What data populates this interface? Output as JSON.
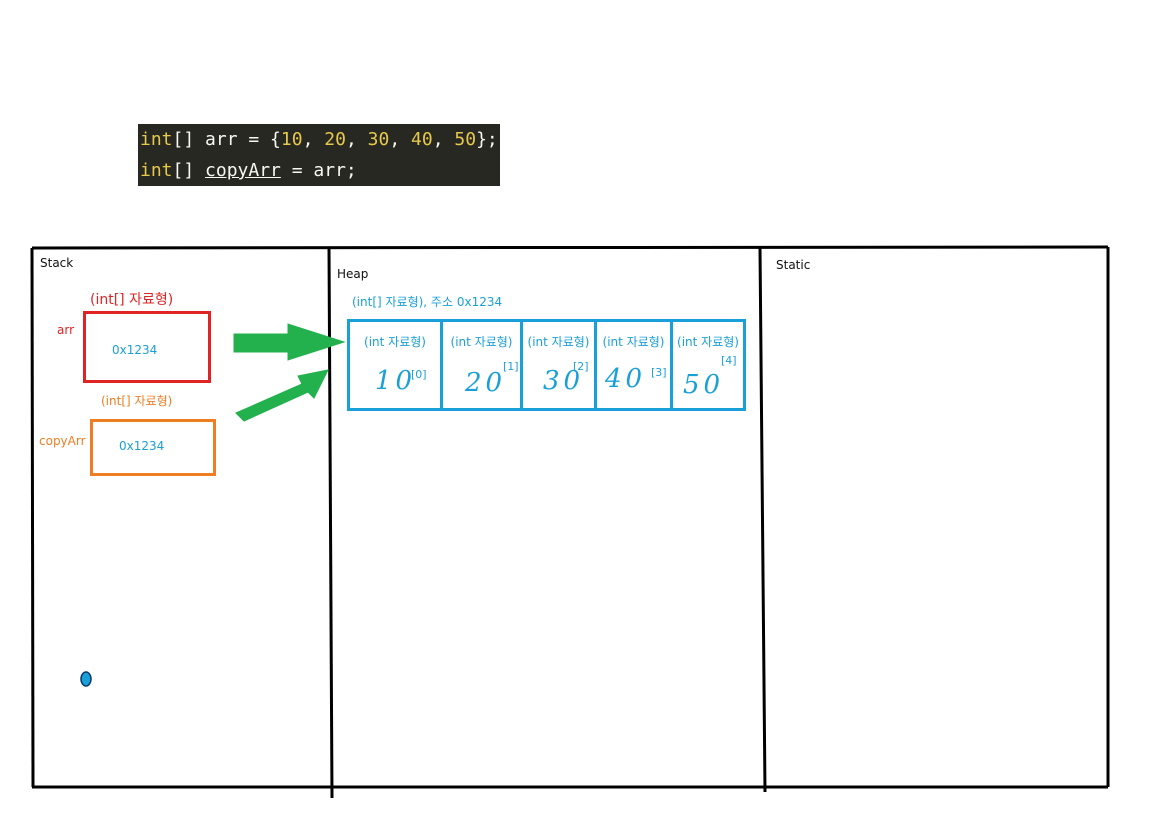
{
  "code": {
    "line1": {
      "kw": "int",
      "rest_a": "[] arr = {",
      "nums": [
        "10",
        "20",
        "30",
        "40",
        "50"
      ],
      "rest_b": "};"
    },
    "line2": {
      "kw": "int",
      "rest_a": "[] ",
      "var": "copyArr",
      "rest_b": " = arr;"
    }
  },
  "regions": {
    "stack": "Stack",
    "heap": "Heap",
    "static": "Static"
  },
  "stack": {
    "arr_type": "(int[] 자료형)",
    "arr_name": "arr",
    "arr_value": "0x1234",
    "copy_type": "(int[] 자료형)",
    "copy_name": "copyArr",
    "copy_value": "0x1234"
  },
  "heap": {
    "array_header": "(int[] 자료형), 주소 0x1234",
    "cells": [
      {
        "type": "(int 자료형)",
        "value": "10",
        "index": "[0]"
      },
      {
        "type": "(int 자료형)",
        "value": "20",
        "index": "[1]"
      },
      {
        "type": "(int 자료형)",
        "value": "30",
        "index": "[2]"
      },
      {
        "type": "(int 자료형)",
        "value": "40",
        "index": "[3]"
      },
      {
        "type": "(int 자료형)",
        "value": "50",
        "index": "[4]"
      }
    ]
  },
  "colors": {
    "arr_box": "#e02424",
    "copy_box": "#ef7d22",
    "heap": "#1aa0d8",
    "arrow": "#22b14c",
    "code_bg": "#272822"
  }
}
